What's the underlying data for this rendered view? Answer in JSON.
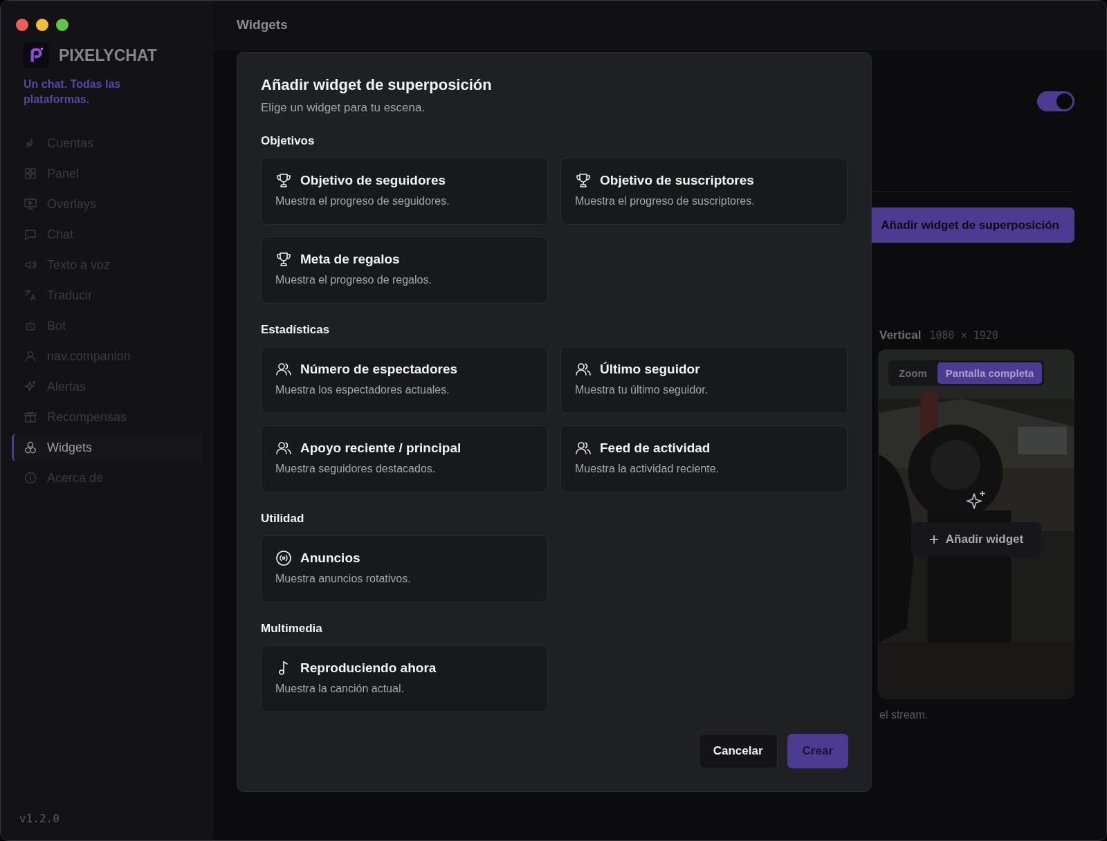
{
  "window": {
    "title": "Widgets"
  },
  "app": {
    "name": "PIXELYCHAT",
    "tagline": "Un chat. Todas las plataformas.",
    "version": "v1.2.0"
  },
  "sidebar": {
    "items": [
      {
        "label": "Cuentas",
        "selected": false
      },
      {
        "label": "Panel",
        "selected": false
      },
      {
        "label": "Overlays",
        "selected": false
      },
      {
        "label": "Chat",
        "selected": false
      },
      {
        "label": "Texto a voz",
        "selected": false
      },
      {
        "label": "Traducir",
        "selected": false
      },
      {
        "label": "Bot",
        "selected": false
      },
      {
        "label": "nav.companion",
        "selected": false
      },
      {
        "label": "Alertas",
        "selected": false
      },
      {
        "label": "Recompensas",
        "selected": false
      },
      {
        "label": "Widgets",
        "selected": true
      },
      {
        "label": "Acerca de",
        "selected": false
      }
    ]
  },
  "background": {
    "toggle": {
      "on": true
    },
    "add_button": "Añadir widget de superposición",
    "preview": {
      "label": "Vertical",
      "size": "1080 × 1920",
      "modes": [
        {
          "label": "Zoom",
          "selected": false
        },
        {
          "label": "Pantalla completa",
          "selected": true
        }
      ],
      "add_widget": "Añadir widget"
    },
    "caption": "el stream."
  },
  "dialog": {
    "title": "Añadir widget de superposición",
    "subtitle": "Elige un widget para tu escena.",
    "sections": [
      {
        "title": "Objetivos",
        "cards": [
          {
            "kind": "trophy",
            "title": "Objetivo de seguidores",
            "description": "Muestra el progreso de seguidores."
          },
          {
            "kind": "trophy",
            "title": "Objetivo de suscriptores",
            "description": "Muestra el progreso de suscriptores."
          },
          {
            "kind": "trophy",
            "title": "Meta de regalos",
            "description": "Muestra el progreso de regalos."
          }
        ]
      },
      {
        "title": "Estadísticas",
        "cards": [
          {
            "kind": "users",
            "title": "Número de espectadores",
            "description": "Muestra los espectadores actuales."
          },
          {
            "kind": "users",
            "title": "Último seguidor",
            "description": "Muestra tu último seguidor."
          },
          {
            "kind": "users",
            "title": "Apoyo reciente / principal",
            "description": "Muestra seguidores destacados."
          },
          {
            "kind": "users",
            "title": "Feed de actividad",
            "description": "Muestra la actividad reciente."
          }
        ]
      },
      {
        "title": "Utilidad",
        "cards": [
          {
            "kind": "broadcast",
            "title": "Anuncios",
            "description": "Muestra anuncios rotativos."
          }
        ]
      },
      {
        "title": "Multimedia",
        "cards": [
          {
            "kind": "music",
            "title": "Reproduciendo ahora",
            "description": "Muestra la canción actual."
          }
        ]
      }
    ],
    "buttons": {
      "cancel": "Cancelar",
      "confirm": "Crear"
    }
  }
}
